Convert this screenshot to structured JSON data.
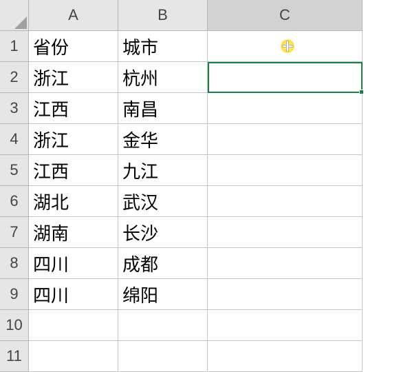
{
  "columns": {
    "A": "A",
    "B": "B",
    "C": "C"
  },
  "rows": {
    "1": "1",
    "2": "2",
    "3": "3",
    "4": "4",
    "5": "5",
    "6": "6",
    "7": "7",
    "8": "8",
    "9": "9",
    "10": "10",
    "11": "11"
  },
  "headers": {
    "A": "省份",
    "B": "城市"
  },
  "cells": {
    "A2": "浙江",
    "B2": "杭州",
    "A3": "江西",
    "B3": "南昌",
    "A4": "浙江",
    "B4": "金华",
    "A5": "江西",
    "B5": "九江",
    "A6": "湖北",
    "B6": "武汉",
    "A7": "湖南",
    "B7": "长沙",
    "A8": "四川",
    "B8": "成都",
    "A9": "四川",
    "B9": "绵阳"
  },
  "selection": {
    "cell": "C2",
    "selected_col": "C"
  },
  "chart_data": {
    "type": "table",
    "columns": [
      "省份",
      "城市"
    ],
    "rows": [
      [
        "浙江",
        "杭州"
      ],
      [
        "江西",
        "南昌"
      ],
      [
        "浙江",
        "金华"
      ],
      [
        "江西",
        "九江"
      ],
      [
        "湖北",
        "武汉"
      ],
      [
        "湖南",
        "长沙"
      ],
      [
        "四川",
        "成都"
      ],
      [
        "四川",
        "绵阳"
      ]
    ]
  }
}
